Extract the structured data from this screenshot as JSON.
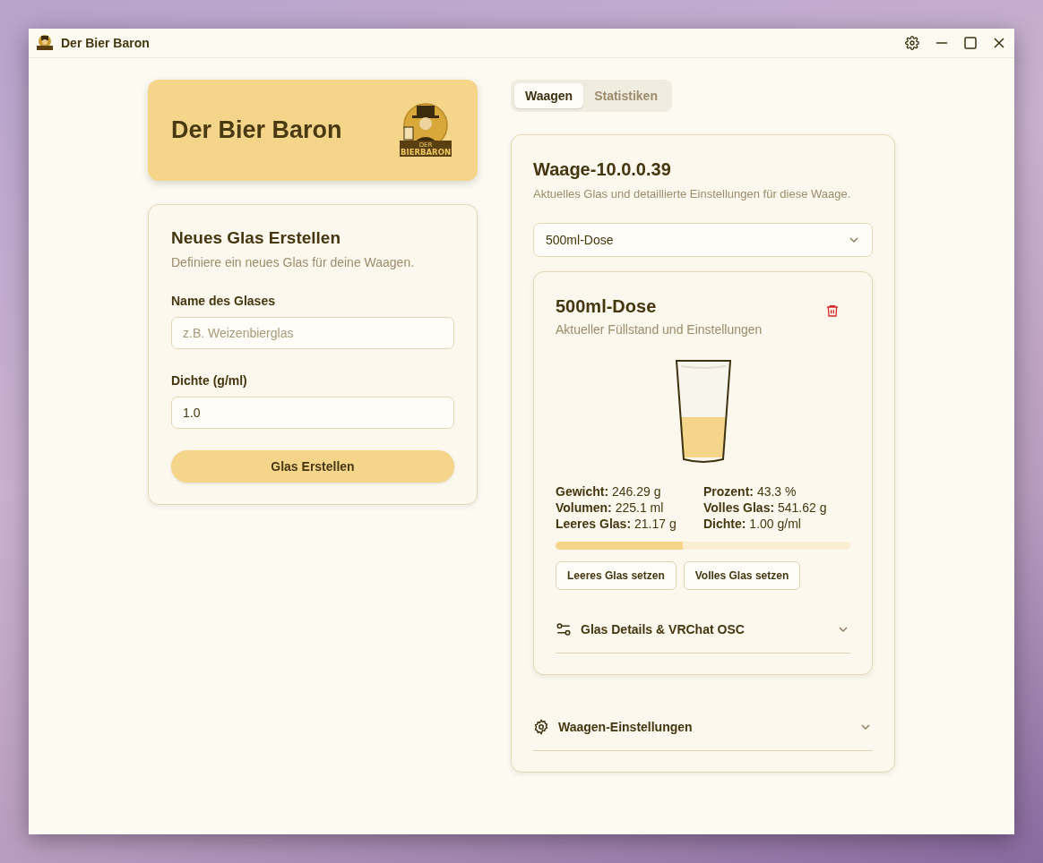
{
  "window": {
    "title": "Der Bier Baron"
  },
  "hero": {
    "title": "Der Bier Baron",
    "logo_text": [
      "DER",
      "BIERBARON"
    ]
  },
  "new_glass": {
    "title": "Neues Glas Erstellen",
    "subtitle": "Definiere ein neues Glas für deine Waagen.",
    "fields": [
      {
        "label": "Name des Glases",
        "placeholder": "z.B. Weizenbierglas"
      },
      {
        "label": "Dichte (g/ml)",
        "value": "1.0"
      }
    ],
    "button": "Glas Erstellen"
  },
  "tabs": [
    {
      "label": "Waagen",
      "selected": true
    },
    {
      "label": "Statistiken",
      "selected": false
    }
  ],
  "scale": {
    "title": "Waage-10.0.0.39",
    "subtitle": "Aktuelles Glas und detaillierte Einstellungen für diese Waage.",
    "glass_select": "500ml-Dose",
    "glass": {
      "title": "500ml-Dose",
      "subtitle": "Aktueller Füllstand und Einstellungen",
      "level": 0.433,
      "stats": [
        "**Gewicht:** 246.29 g",
        "**Prozent:** 43.3 %",
        "**Volumen:** 225.1 ml",
        "**Volles Glas:** 541.62 g",
        "**Leeres Glas:** 21.17 g",
        "**Dichte:** 1.00 g/ml"
      ],
      "buttons": [
        "Leeres Glas setzen",
        "Volles Glas setzen"
      ],
      "details": {
        "label": "Glas Details & VRChat OSC",
        "expanded": false
      }
    },
    "settings": {
      "label": "Waagen-Einstellungen",
      "expanded": false
    }
  }
}
